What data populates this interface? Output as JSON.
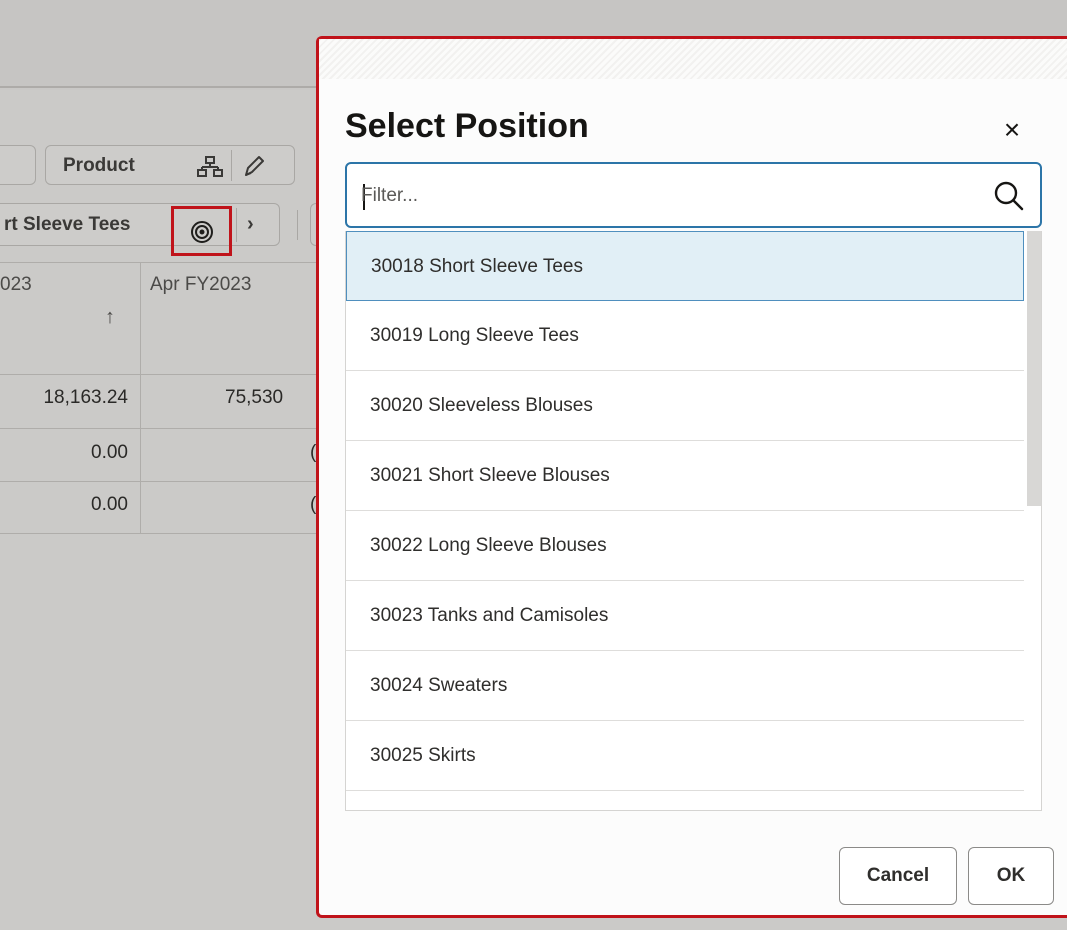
{
  "background": {
    "toolbar": {
      "product_label": "Product",
      "member_label": "rt Sleeve Tees",
      "hierarchy_icon": "hierarchy-icon",
      "edit_icon": "pencil-icon",
      "target_icon": "target-icon",
      "next_icon": "chevron-right-icon"
    },
    "grid": {
      "col1_header": "023",
      "col2_header": "Apr FY2023",
      "sort_icon": "↑",
      "col1_values": [
        "18,163.24",
        "0.00",
        "0.00"
      ],
      "col2_values": [
        "75,530",
        "(",
        "("
      ]
    }
  },
  "dialog": {
    "title": "Select Position",
    "close_label": "×",
    "filter": {
      "placeholder": "Filter...",
      "value": ""
    },
    "items": [
      {
        "label": "30018 Short Sleeve Tees",
        "selected": true
      },
      {
        "label": "30019 Long Sleeve Tees",
        "selected": false
      },
      {
        "label": "30020 Sleeveless Blouses",
        "selected": false
      },
      {
        "label": "30021 Short Sleeve Blouses",
        "selected": false
      },
      {
        "label": "30022 Long Sleeve Blouses",
        "selected": false
      },
      {
        "label": "30023 Tanks and Camisoles",
        "selected": false
      },
      {
        "label": "30024 Sweaters",
        "selected": false
      },
      {
        "label": "30025 Skirts",
        "selected": false
      }
    ],
    "cancel_label": "Cancel",
    "ok_label": "OK"
  },
  "colors": {
    "highlight_border": "#c0131a",
    "selected_row": "#e1eff6",
    "focus_border": "#2c75a8"
  }
}
